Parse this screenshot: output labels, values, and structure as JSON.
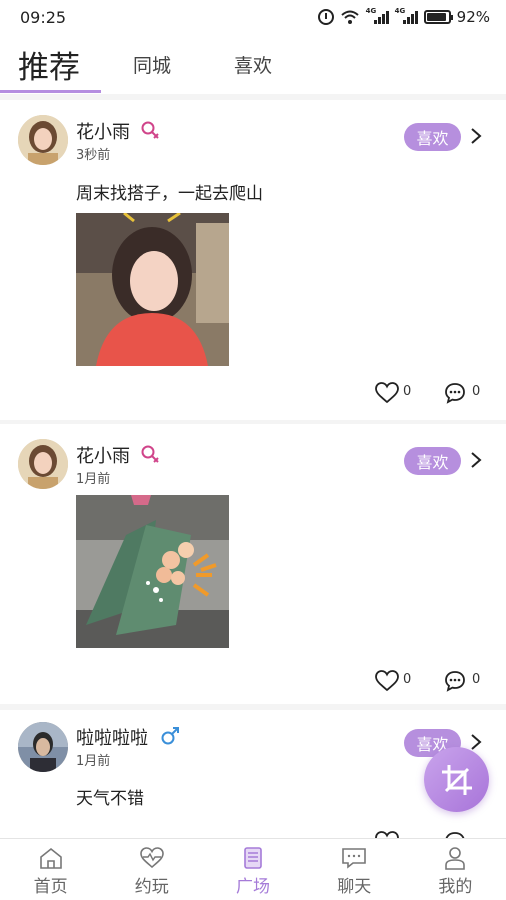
{
  "status_bar": {
    "time": "09:25",
    "signal1_label": "4G",
    "signal2_label": "4G",
    "battery": "92%",
    "battery_level": 0.92
  },
  "top_tabs": [
    {
      "label": "推荐",
      "active": true
    },
    {
      "label": "同城",
      "active": false
    },
    {
      "label": "喜欢",
      "active": false
    }
  ],
  "posts": [
    {
      "name": "花小雨",
      "gender": "female",
      "gender_icon": "female-symbol-icon",
      "time": "3秒前",
      "badge": "喜欢",
      "text": "周末找搭子，一起去爬山",
      "photo": "selfie-photo",
      "likes": "0",
      "comments": "0"
    },
    {
      "name": "花小雨",
      "gender": "female",
      "gender_icon": "female-symbol-icon",
      "time": "1月前",
      "badge": "喜欢",
      "text": "",
      "photo": "flower-bouquet-photo",
      "likes": "0",
      "comments": "0"
    },
    {
      "name": "啦啦啦啦",
      "gender": "male",
      "gender_icon": "male-symbol-icon",
      "time": "1月前",
      "badge": "喜欢",
      "text": "天气不错",
      "photo": "",
      "likes": "",
      "comments": ""
    }
  ],
  "fab": {
    "icon": "crop-icon"
  },
  "bottom_nav": [
    {
      "label": "首页",
      "icon": "home-icon",
      "active": false
    },
    {
      "label": "约玩",
      "icon": "heart-pulse-icon",
      "active": false
    },
    {
      "label": "广场",
      "icon": "square-doc-icon",
      "active": true
    },
    {
      "label": "聊天",
      "icon": "chat-icon",
      "active": false
    },
    {
      "label": "我的",
      "icon": "profile-icon",
      "active": false
    }
  ],
  "colors": {
    "accent": "#b68fde",
    "female": "#d0448a",
    "male": "#3a8fd9",
    "active_nav": "#a57bd8"
  }
}
